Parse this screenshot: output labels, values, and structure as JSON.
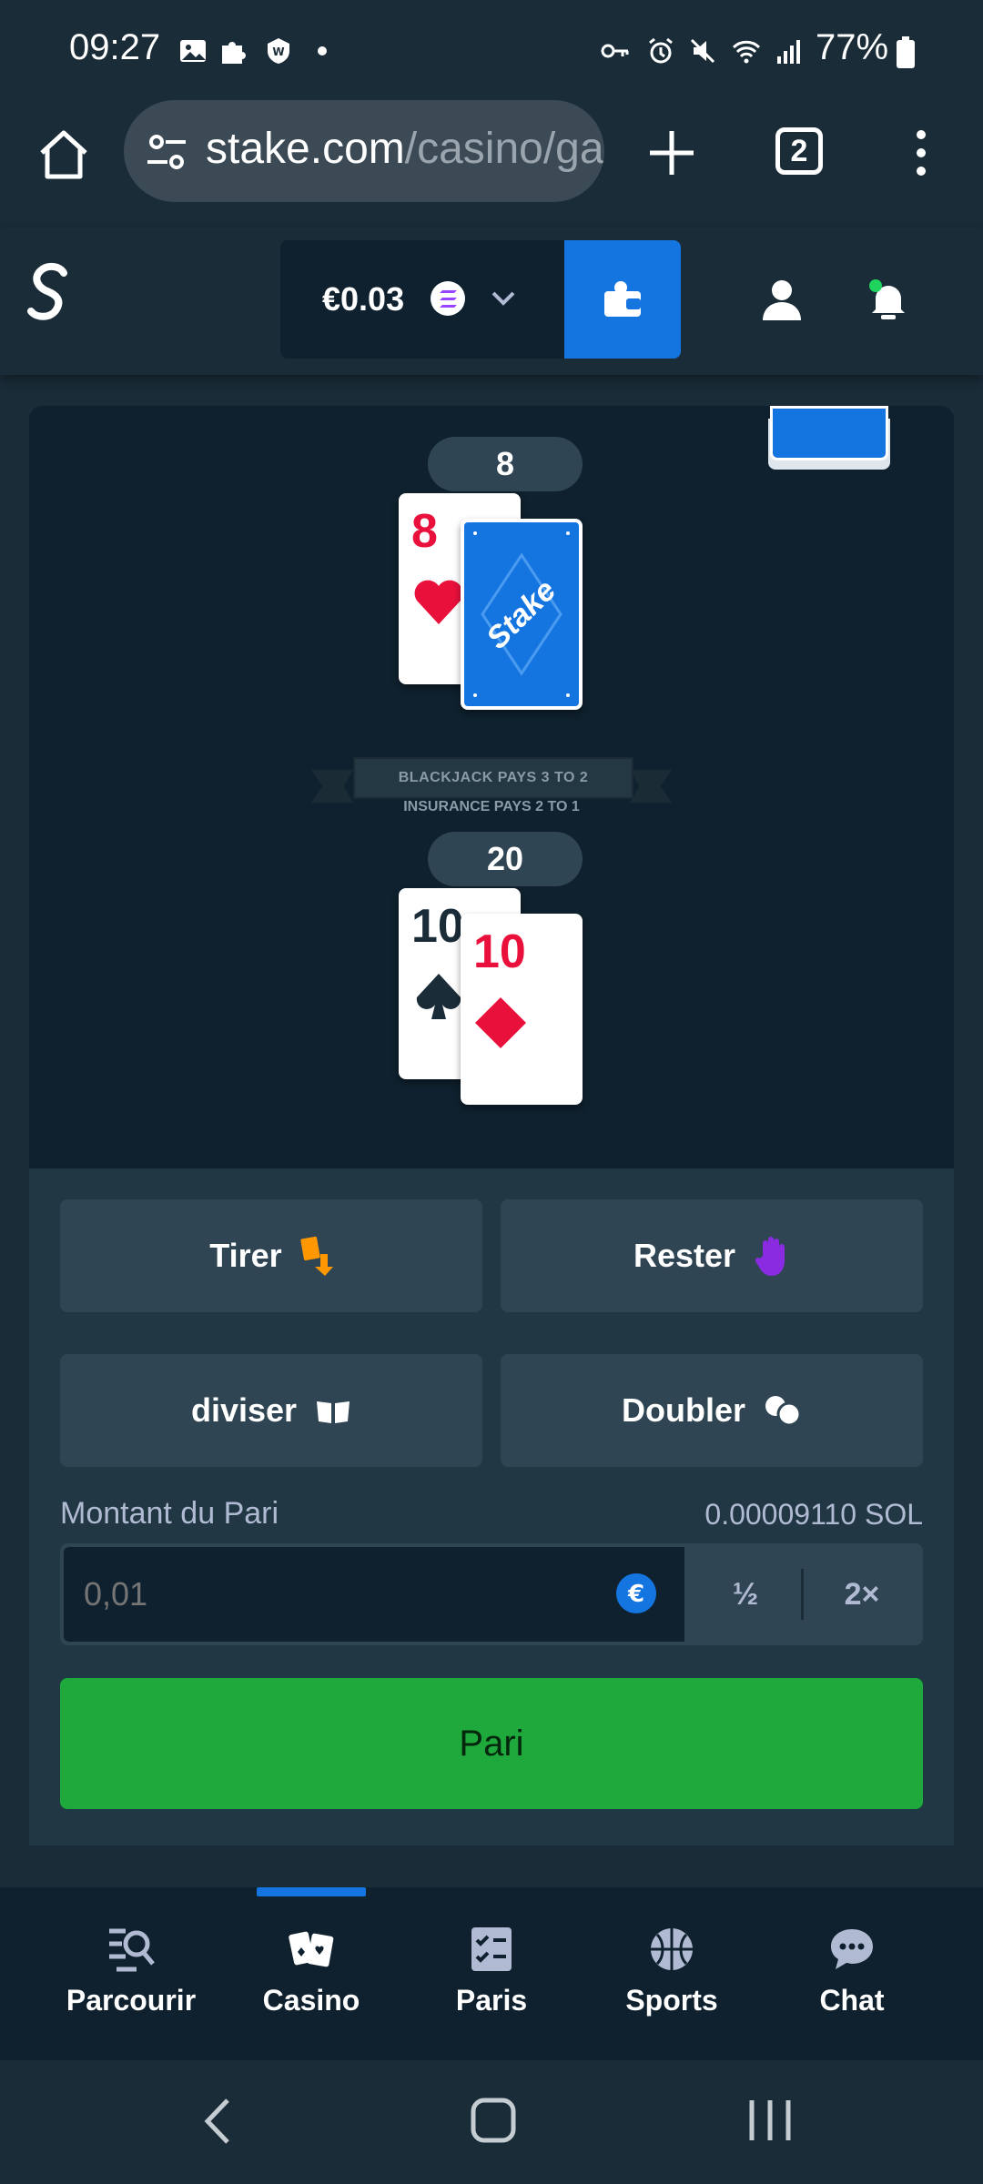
{
  "status_bar": {
    "time": "09:27",
    "battery": "77%",
    "left_icons": [
      "image-icon",
      "puzzle-icon",
      "shield-icon",
      "dot-icon"
    ],
    "right_icons": [
      "key-icon",
      "alarm-icon",
      "mute-icon",
      "wifi-icon",
      "signal-icon",
      "battery-icon"
    ]
  },
  "browser": {
    "url_host": "stake.com",
    "url_path": "/casino/ga",
    "tab_count": "2"
  },
  "header": {
    "balance": "€0.03",
    "colors": {
      "wallet": "#1475e1",
      "bg": "#1a2c38"
    }
  },
  "game": {
    "dealer": {
      "total": "8",
      "cards": [
        {
          "rank": "8",
          "suit": "heart"
        },
        {
          "face_down": true,
          "back_label": "Stake"
        }
      ]
    },
    "player": {
      "total": "20",
      "cards": [
        {
          "rank": "10",
          "suit": "spade"
        },
        {
          "rank": "10",
          "suit": "diamond"
        }
      ]
    },
    "banner": "BLACKJACK PAYS 3 TO 2",
    "insurance": "INSURANCE PAYS 2 TO 1"
  },
  "actions": {
    "hit": "Tirer",
    "stand": "Rester",
    "split": "diviser",
    "double": "Doubler"
  },
  "bet": {
    "label": "Montant du Pari",
    "conversion": "0.00009110 SOL",
    "placeholder": "0,01",
    "half": "½",
    "double": "2×",
    "button": "Pari",
    "colors": {
      "button": "#1fa83c"
    }
  },
  "nav": {
    "items": [
      {
        "label": "Parcourir",
        "icon": "browse-icon"
      },
      {
        "label": "Casino",
        "icon": "cards-icon"
      },
      {
        "label": "Paris",
        "icon": "betslip-icon"
      },
      {
        "label": "Sports",
        "icon": "basketball-icon"
      },
      {
        "label": "Chat",
        "icon": "chat-icon"
      }
    ],
    "active": "Casino"
  }
}
